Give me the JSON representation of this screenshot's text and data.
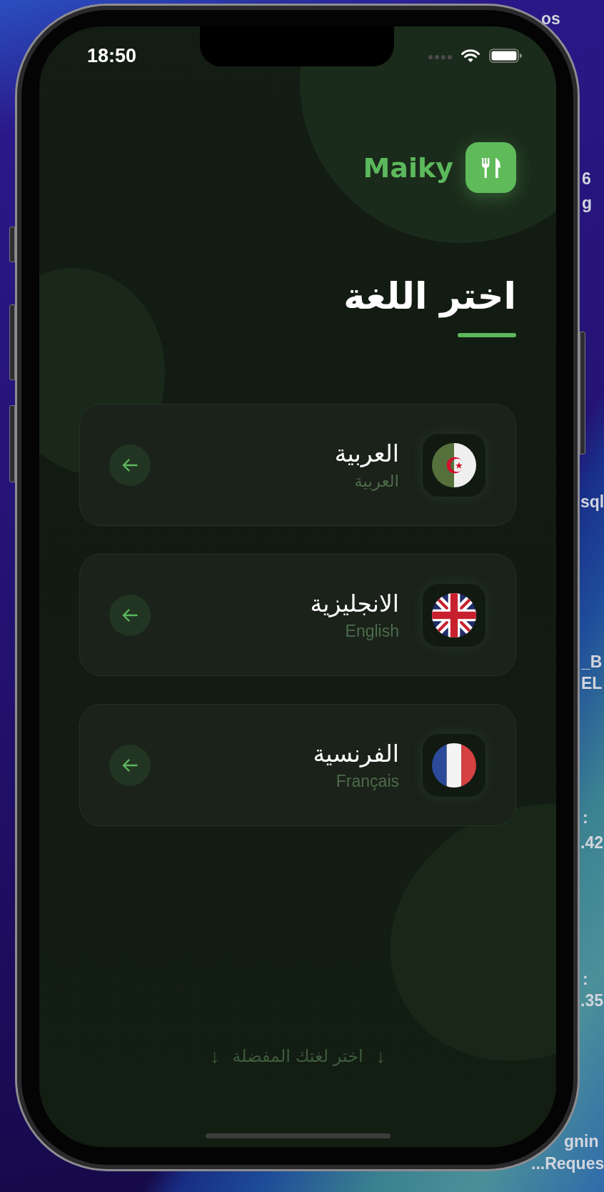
{
  "desktop": {
    "fragments": [
      "os",
      "6",
      "g",
      "sql",
      "_B",
      "EL",
      ":",
      ".42",
      ":",
      ".35",
      "gnin",
      "...Reques"
    ]
  },
  "status_bar": {
    "time": "18:50"
  },
  "brand": {
    "name": "Maiky"
  },
  "title": "اختر اللغة",
  "languages": [
    {
      "kind": "algeria",
      "name": "العربية",
      "native": "العربية"
    },
    {
      "kind": "uk",
      "name": "الانجليزية",
      "native": "English"
    },
    {
      "kind": "france",
      "name": "الفرنسية",
      "native": "Français"
    }
  ],
  "hint": {
    "arrow_start": "↓",
    "text": "اختر لغتك المفضلة",
    "arrow_end": "↓"
  }
}
